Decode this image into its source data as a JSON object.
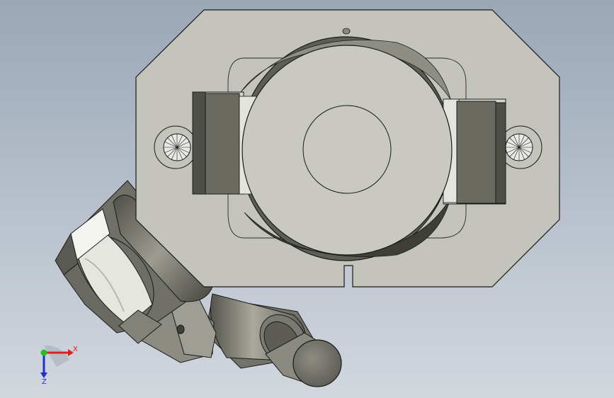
{
  "viewport": {
    "background_top": "#9aa7b7",
    "background_bottom": "#d2d7de"
  },
  "model": {
    "body_color": "#c4c4bc",
    "dark_metal_color": "#6a6a60",
    "edge_color": "#1a1a1a",
    "highlight_color": "#f2f2ee"
  },
  "triad": {
    "x_label": "X",
    "z_label": "Z",
    "x_color": "#e0201c",
    "y_color": "#20c020",
    "z_color": "#2030d0"
  }
}
